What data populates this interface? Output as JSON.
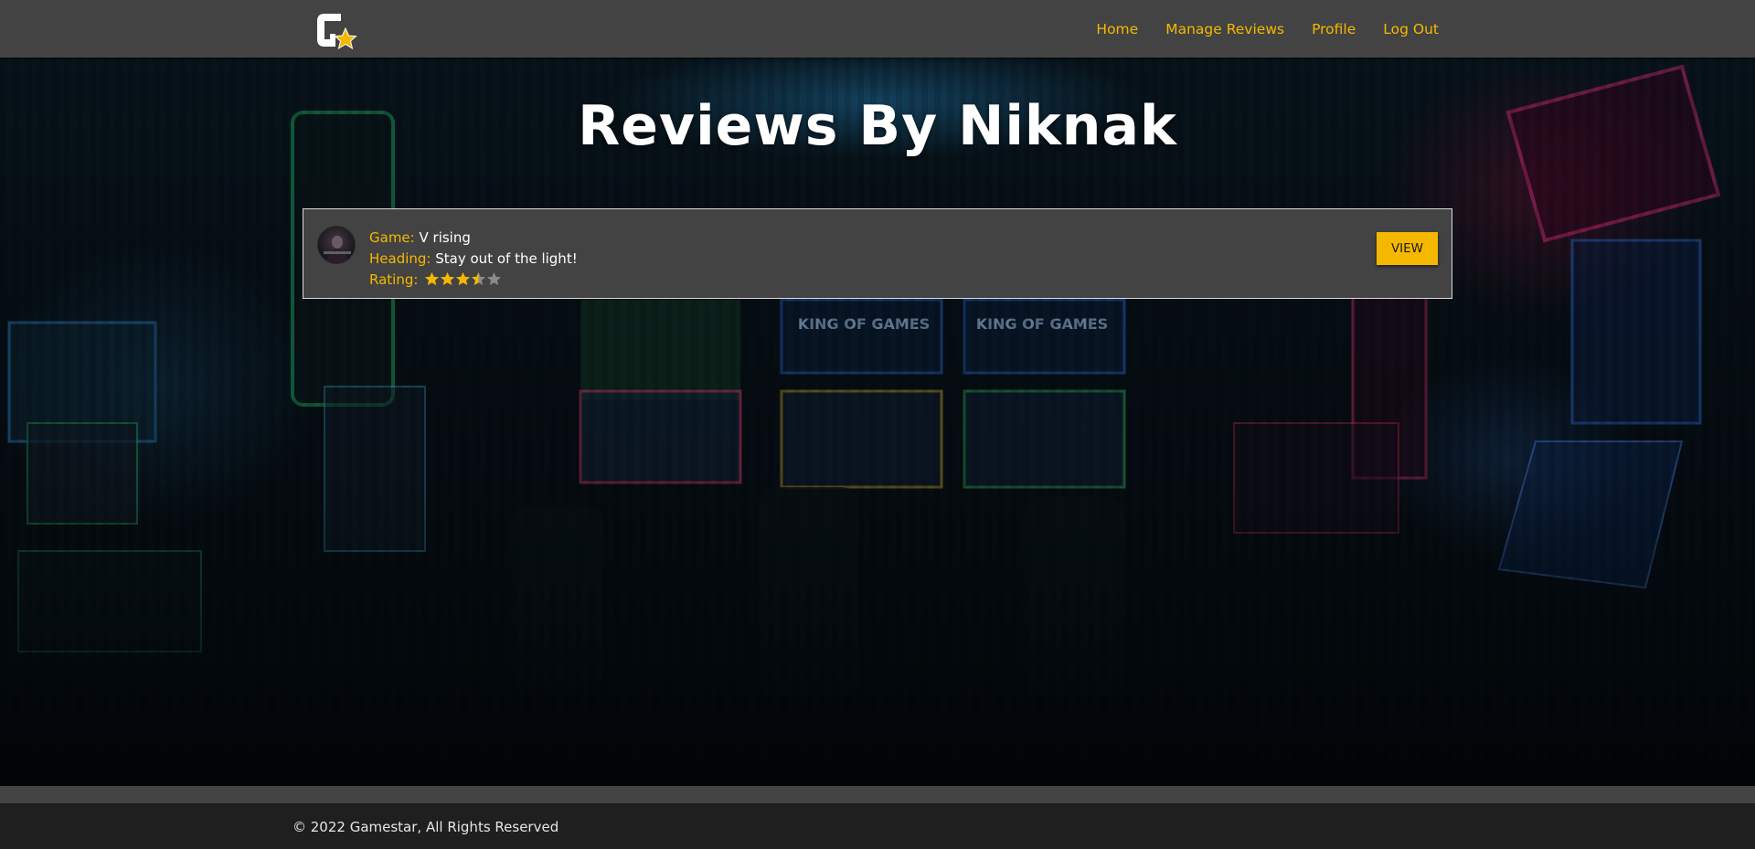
{
  "nav": {
    "logo_icon": "gamestar-logo-icon",
    "links": [
      "Home",
      "Manage Reviews",
      "Profile",
      "Log Out"
    ]
  },
  "hero": {
    "title": "Reviews By Niknak"
  },
  "reviews": [
    {
      "game_label": "Game:",
      "game": "V rising",
      "heading_label": "Heading:",
      "heading": "Stay out of the light!",
      "rating_label": "Rating:",
      "rating": 3.5,
      "rating_max": 5,
      "view_label": "VIEW"
    }
  ],
  "footer": {
    "copyright": "© 2022 Gamestar, All Rights Reserved"
  },
  "colors": {
    "accent": "#f5b800",
    "navbar": "#434343",
    "card": "#434343",
    "footer": "#1f1f1f"
  }
}
